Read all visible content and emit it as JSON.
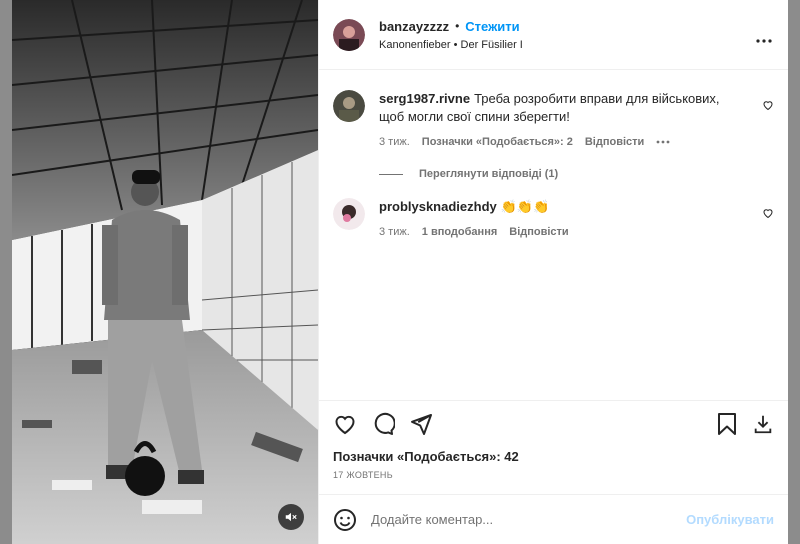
{
  "post": {
    "author": "banzayzzzz",
    "separator": "•",
    "follow_label": "Стежити",
    "subtitle": "Kanonenfieber • Der Füsilier I",
    "likes_text": "Позначки «Подобається»: 42",
    "date": "17 ЖОВТЕНЬ"
  },
  "comments": [
    {
      "user": "serg1987.rivne",
      "text": "Треба розробити вправи для військових, щоб могли свої спини зберегти!",
      "time": "3 тиж.",
      "likes": "Позначки «Подобається»: 2",
      "reply": "Відповісти",
      "view_replies": "Переглянути відповіді (1)"
    },
    {
      "user": "problysknadiezhdy",
      "text": "👏👏👏",
      "time": "3 тиж.",
      "likes": "1 вподобання",
      "reply": "Відповісти"
    }
  ],
  "composer": {
    "placeholder": "Додайте коментар...",
    "post_label": "Опублікувати"
  },
  "icons": {
    "like": "heart-icon",
    "comment": "comment-icon",
    "share": "share-icon",
    "save": "bookmark-icon",
    "download": "download-icon",
    "emoji": "emoji-icon",
    "more": "more-icon",
    "mute": "mute-icon"
  },
  "colors": {
    "accent": "#0095f6",
    "post_disabled": "#b3dbff",
    "secondary_text": "#737373"
  }
}
